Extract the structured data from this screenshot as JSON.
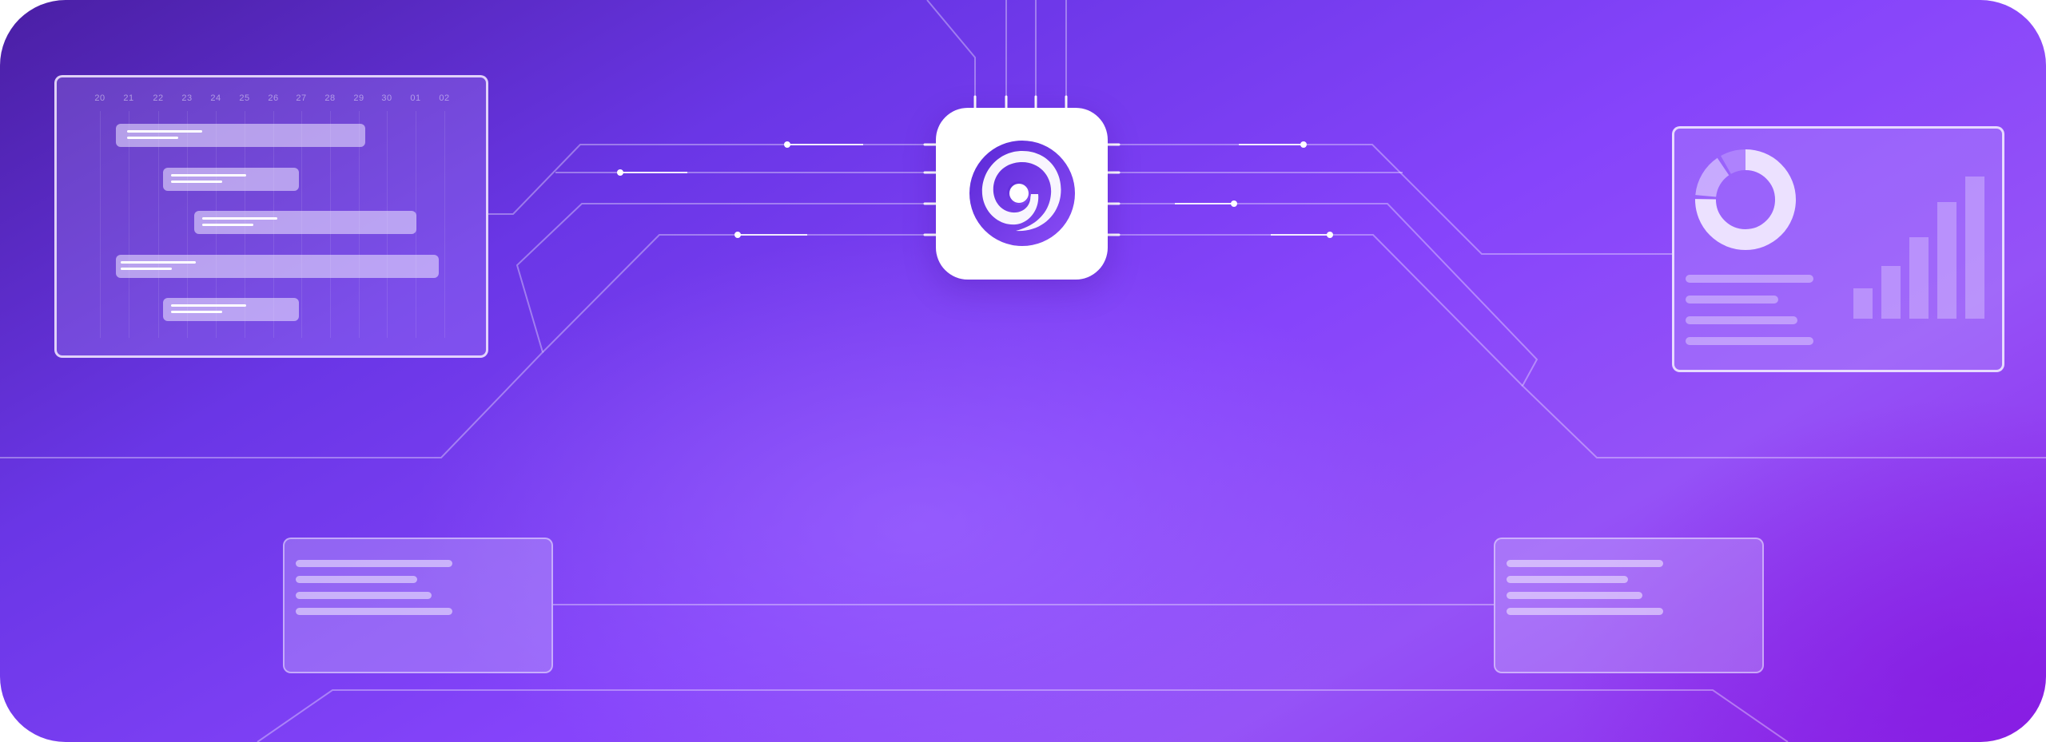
{
  "banner": {
    "accent": "#6f3ef0",
    "background_start": "#4a1fa4",
    "background_end": "#8b22e8"
  },
  "logo": {
    "icon": "swirl-logo-icon"
  },
  "gantt": {
    "dates": [
      "20",
      "21",
      "22",
      "23",
      "24",
      "25",
      "26",
      "27",
      "28",
      "29",
      "30",
      "01",
      "02"
    ],
    "icon": "timeline-chart"
  },
  "dashboard": {
    "icons": [
      "donut-chart-icon",
      "bar-chart-icon"
    ]
  },
  "notes": {
    "icons": [
      "text-card-icon",
      "text-card-icon"
    ]
  }
}
